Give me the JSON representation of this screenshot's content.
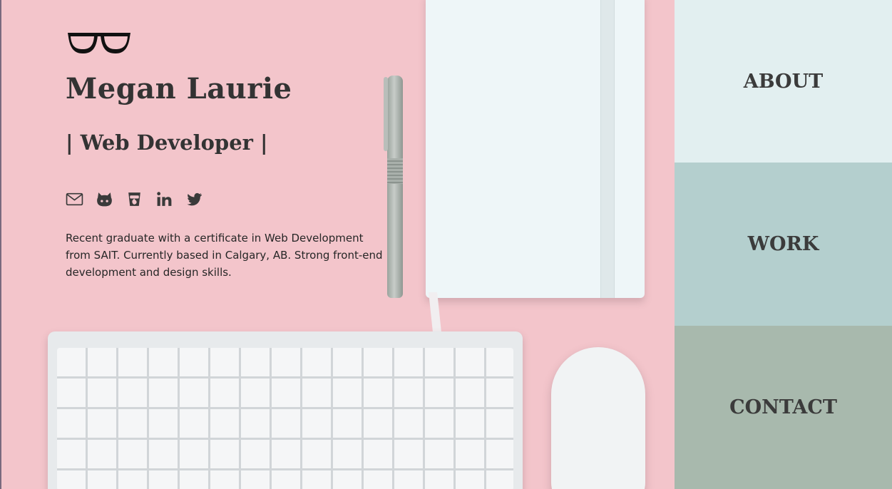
{
  "profile": {
    "logo_icon": "glasses-icon",
    "name": "Megan Laurie",
    "role": "| Web Developer |",
    "bio": "Recent graduate with a certificate in Web Development from SAIT. Currently based in Calgary, AB. Strong front-end development and design skills."
  },
  "socials": [
    {
      "icon": "email-icon"
    },
    {
      "icon": "github-icon"
    },
    {
      "icon": "freecodecamp-icon"
    },
    {
      "icon": "linkedin-icon"
    },
    {
      "icon": "twitter-icon"
    }
  ],
  "nav": {
    "about_label": "ABOUT",
    "work_label": "WORK",
    "contact_label": "CONTACT"
  },
  "colors": {
    "hero_background": "#f3c5cb",
    "about_panel": "#e2eff0",
    "work_panel": "#b4cfce",
    "contact_panel": "#a8b9ad",
    "text": "#333333"
  }
}
